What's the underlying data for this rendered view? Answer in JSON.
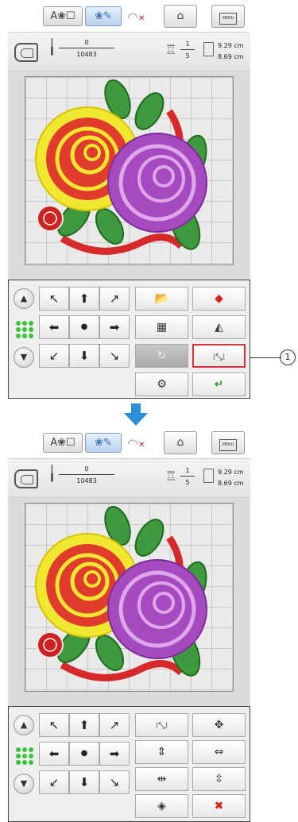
{
  "top": {
    "mode_text": "A❀☐",
    "mode_embroidery": "❀✎",
    "menu_label": "MENU",
    "stitch_current": "0",
    "stitch_total": "10483",
    "color_current": "1",
    "color_total": "5",
    "width": "9.29 cm",
    "height": "8.69 cm"
  },
  "callout_label": "1",
  "control_left": {
    "arrows": [
      "↖",
      "⬆",
      "↗",
      "⬅",
      "●",
      "➡",
      "↙",
      "⬇",
      "↘"
    ]
  },
  "colors": {
    "highlight": "#d7313c",
    "green": "#2ba02b",
    "red_x": "#d9261c",
    "arrow_blue": "#2b8fd6"
  }
}
